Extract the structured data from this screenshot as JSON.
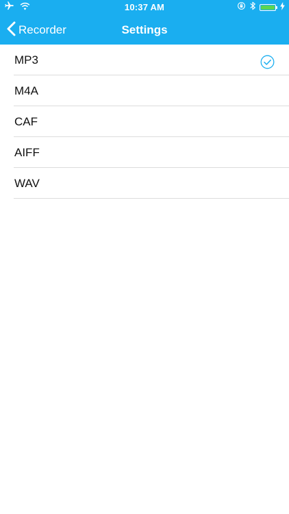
{
  "status_bar": {
    "time": "10:37 AM",
    "icons_left": [
      "airplane-icon",
      "wifi-icon"
    ],
    "icons_right": [
      "orientation-lock-icon",
      "bluetooth-icon",
      "battery-icon",
      "charging-icon"
    ],
    "battery_level": 1.0,
    "battery_color": "#5bd651"
  },
  "nav": {
    "back_label": "Recorder",
    "title": "Settings",
    "background_color": "#1aaef0"
  },
  "formats": [
    {
      "label": "MP3",
      "selected": true
    },
    {
      "label": "M4A",
      "selected": false
    },
    {
      "label": "CAF",
      "selected": false
    },
    {
      "label": "AIFF",
      "selected": false
    },
    {
      "label": "WAV",
      "selected": false
    }
  ],
  "accent_color": "#1aaef0"
}
